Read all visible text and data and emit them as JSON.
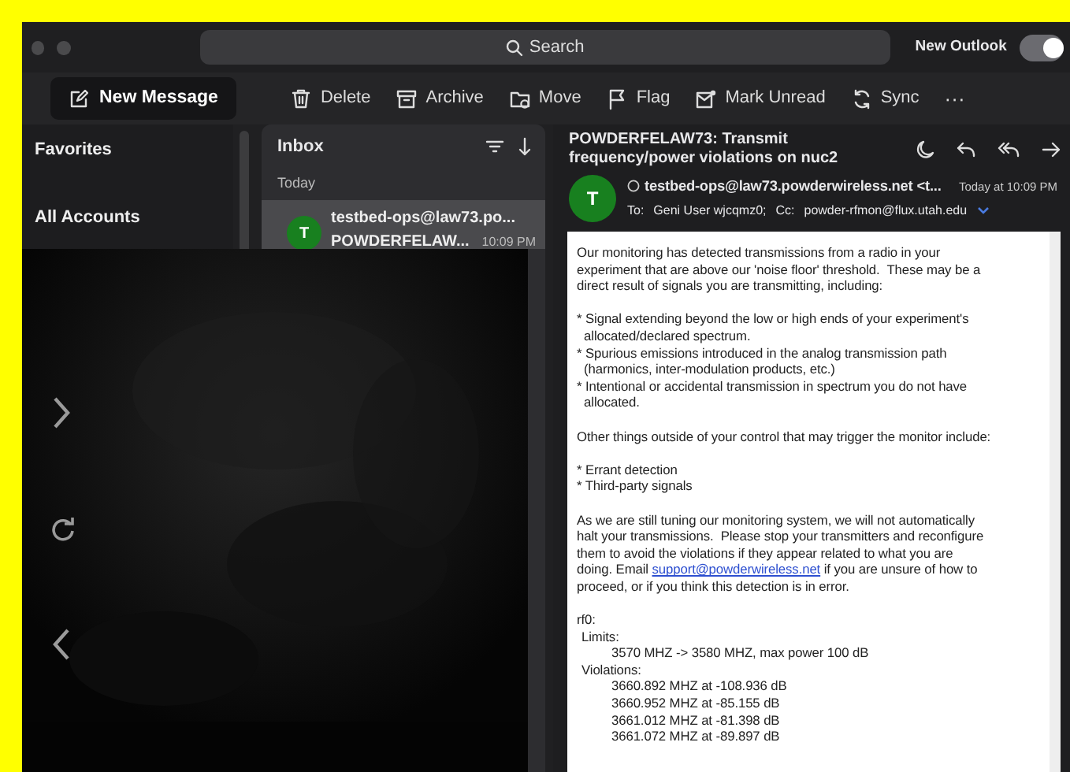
{
  "window": {
    "search_placeholder": "Search",
    "new_outlook": {
      "label": "New Outlook",
      "on": true
    }
  },
  "toolbar": {
    "new_message": "New Message",
    "actions": [
      {
        "label": "Delete"
      },
      {
        "label": "Archive"
      },
      {
        "label": "Move"
      },
      {
        "label": "Flag"
      },
      {
        "label": "Mark Unread"
      },
      {
        "label": "Sync"
      }
    ],
    "more": "···"
  },
  "sidebar": {
    "items": [
      {
        "label": "Favorites"
      },
      {
        "label": "All Accounts"
      }
    ]
  },
  "inbox": {
    "title": "Inbox",
    "group": "Today",
    "messages": [
      {
        "avatar": "T",
        "sender": "testbed-ops@law73.po...",
        "subject": "POWDERFELAW...",
        "time": "10:09 PM",
        "selected": true
      }
    ]
  },
  "message": {
    "subject": "POWDERFELAW73: Transmit frequency/power violations on nuc2",
    "avatar": "T",
    "sender": "testbed-ops@law73.powderwireless.net <t...",
    "time": "Today at 10:09 PM",
    "to_label": "To:",
    "to": "Geni User wjcqmz0;",
    "cc_label": "Cc:",
    "cc": "powder-rfmon@flux.utah.edu",
    "body": [
      {
        "kind": "para",
        "text": "Our monitoring has detected transmissions from a radio in your\nexperiment that are above our 'noise floor' threshold.  These may be a\ndirect result of signals you are transmitting, including:"
      },
      {
        "kind": "bullets",
        "items": [
          "* Signal extending beyond the low or high ends of your experiment's\n  allocated/declared spectrum.",
          "* Spurious emissions introduced in the analog transmission path\n  (harmonics, inter-modulation products, etc.)",
          "* Intentional or accidental transmission in spectrum you do not have\n  allocated."
        ]
      },
      {
        "kind": "para",
        "text": "Other things outside of your control that may trigger the monitor include:"
      },
      {
        "kind": "bullets",
        "items": [
          "* Errant detection",
          "* Third-party signals"
        ]
      },
      {
        "kind": "linkpara",
        "segments": [
          {
            "text": "As we are still tuning our monitoring system, we will not automatically\nhalt your transmissions.  Please stop your transmitters and reconfigure\nthem to avoid the violations if they appear related to what you are\ndoing. Email "
          },
          {
            "link": "support@powderwireless.net"
          },
          {
            "text": " if you are unsure of how to\nproceed, or if you think this detection is in error."
          }
        ]
      },
      {
        "kind": "tree",
        "title": "rf0:",
        "children": [
          {
            "title": "Limits:",
            "children": [
              {
                "title": "3570 MHZ -> 3580 MHZ, max power 100 dB"
              }
            ]
          },
          {
            "title": "Violations:",
            "children": [
              {
                "title": "3660.892 MHZ at -108.936 dB"
              },
              {
                "title": "3660.952 MHZ at -85.155 dB"
              },
              {
                "title": "3661.012 MHZ at -81.398 dB"
              },
              {
                "title": "3661.072 MHZ at -89.897 dB"
              }
            ]
          }
        ]
      }
    ]
  }
}
